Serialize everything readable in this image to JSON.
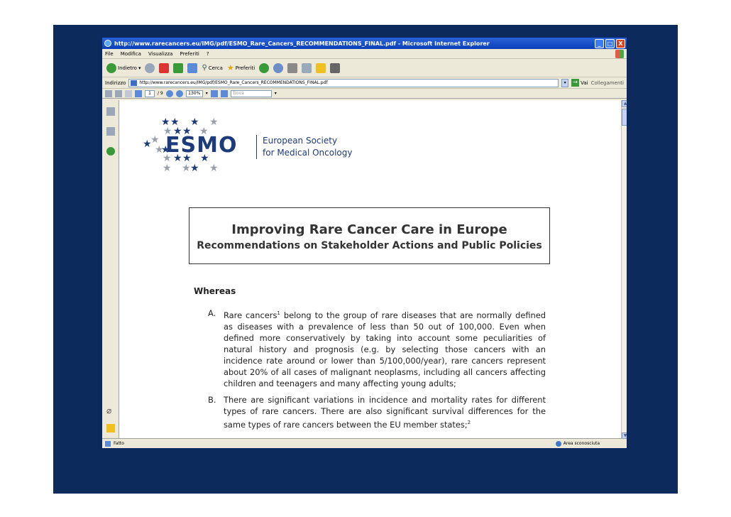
{
  "window": {
    "title": "http://www.rarecancers.eu/IMG/pdf/ESMO_Rare_Cancers_RECOMMENDATIONS_FINAL.pdf - Microsoft Internet Explorer",
    "btn_min": "_",
    "btn_max": "□",
    "btn_close": "X"
  },
  "menu": {
    "items": [
      "File",
      "Modifica",
      "Visualizza",
      "Preferiti",
      "?"
    ]
  },
  "toolbar": {
    "back_label": "Indietro",
    "search_label": "Cerca",
    "favorites_label": "Preferiti"
  },
  "address": {
    "label": "Indirizzo",
    "url": "http://www.rarecancers.eu/IMG/pdf/ESMO_Rare_Cancers_RECOMMENDATIONS_FINAL.pdf",
    "go_label": "Vai",
    "links_label": "Collegamenti"
  },
  "pdf_toolbar": {
    "page_current": "1",
    "page_total": "/ 9",
    "zoom": "130%",
    "find_placeholder": "Trova"
  },
  "document": {
    "logo_text": "ESMO",
    "logo_sub1": "European Society",
    "logo_sub2": "for Medical Oncology",
    "title": "Improving Rare Cancer Care in Europe",
    "subtitle": "Recommendations on Stakeholder Actions and Public Policies",
    "whereas": "Whereas",
    "para_a_letter": "A.",
    "para_a_start": "Rare cancers",
    "para_a_sup": "1",
    "para_a_text": " belong to the group of rare diseases that are normally defined as diseases with a prevalence of less than 50 out of 100,000. Even when defined more conservatively by taking into account some peculiarities of natural history and prognosis (e.g. by selecting those cancers with an incidence rate around or lower than 5/100,000/year), rare cancers represent about 20% of all cases of malignant neoplasms, including all cancers affecting children and teenagers and many affecting young adults;",
    "para_b_letter": "B.",
    "para_b_text": "There are significant variations in incidence and mortality rates for different types of rare cancers.  There are also significant survival differences for the same types of rare cancers between the EU member states;",
    "para_b_sup": "2"
  },
  "status": {
    "left": "Fatto",
    "zone": "Area sconosciuta"
  },
  "colors": {
    "slide_bg": "#0d2a5c",
    "titlebar": "#0b3fb8",
    "logo_blue": "#1d3b7a"
  }
}
